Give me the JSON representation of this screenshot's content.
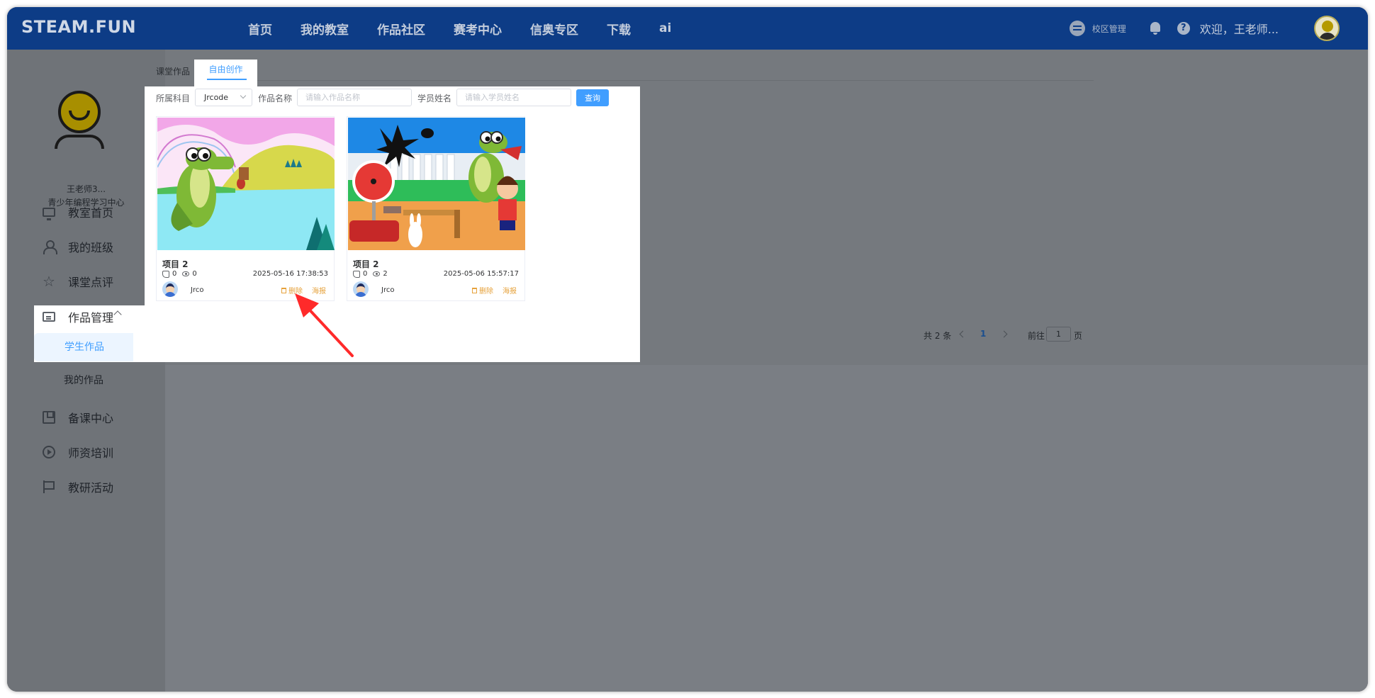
{
  "header": {
    "logo": "STEAM.FUN",
    "nav": [
      "首页",
      "我的教室",
      "作品社区",
      "赛考中心",
      "信奥专区",
      "下载",
      "ai"
    ],
    "campus": "校区管理",
    "welcome": "欢迎，王老师..."
  },
  "sidebar": {
    "user_name": "王老师3...",
    "user_org": "青少年编程学习中心",
    "items": {
      "home": "教室首页",
      "class": "我的班级",
      "review": "课堂点评",
      "works": "作品管理",
      "student_works": "学生作品",
      "my_works": "我的作品",
      "prep": "备课中心",
      "training": "师资培训",
      "research": "教研活动"
    }
  },
  "tabs": {
    "classwork": "课堂作品",
    "free": "自由创作"
  },
  "filters": {
    "subject_label": "所属科目",
    "subject_value": "Jrcode",
    "work_name_label": "作品名称",
    "work_name_placeholder": "请输入作品名称",
    "student_label": "学员姓名",
    "student_placeholder": "请输入学员姓名",
    "query": "查询"
  },
  "cards": [
    {
      "title": "项目 2",
      "likes": "0",
      "views": "0",
      "date": "2025-05-16 17:38:53",
      "author": "Jrco",
      "delete": "删除",
      "poster": "海报"
    },
    {
      "title": "项目 2",
      "likes": "0",
      "views": "2",
      "date": "2025-05-06 15:57:17",
      "author": "Jrco",
      "delete": "删除",
      "poster": "海报"
    }
  ],
  "pagination": {
    "total": "共 2 条",
    "page": "1",
    "goto": "前往",
    "input": "1",
    "page_word": "页"
  },
  "colors": {
    "header_bg": "#0d3c86",
    "accent": "#409eff",
    "warning": "#e6a23c",
    "arrow": "#ff2a2a"
  }
}
